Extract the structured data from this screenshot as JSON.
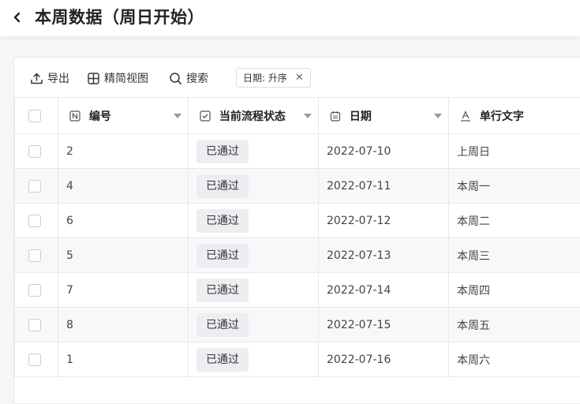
{
  "header": {
    "title": "本周数据（周日开始）"
  },
  "toolbar": {
    "export_label": "导出",
    "view_label": "精简视图",
    "search_label": "搜索",
    "filter_chip": "日期: 升序"
  },
  "table": {
    "columns": [
      "编号",
      "当前流程状态",
      "日期",
      "单行文字"
    ],
    "rows": [
      {
        "id": "2",
        "status": "已通过",
        "date": "2022-07-10",
        "text": "上周日"
      },
      {
        "id": "4",
        "status": "已通过",
        "date": "2022-07-11",
        "text": "本周一"
      },
      {
        "id": "6",
        "status": "已通过",
        "date": "2022-07-12",
        "text": "本周二"
      },
      {
        "id": "5",
        "status": "已通过",
        "date": "2022-07-13",
        "text": "本周三"
      },
      {
        "id": "7",
        "status": "已通过",
        "date": "2022-07-14",
        "text": "本周四"
      },
      {
        "id": "8",
        "status": "已通过",
        "date": "2022-07-15",
        "text": "本周五"
      },
      {
        "id": "1",
        "status": "已通过",
        "date": "2022-07-16",
        "text": "本周六"
      }
    ]
  },
  "icons": {
    "back": "chevron-left-icon",
    "export": "upload-icon",
    "view": "grid-icon",
    "search": "search-icon",
    "number_col": "number-field-icon",
    "status_col": "checkbox-field-icon",
    "date_col": "calendar-field-icon",
    "text_col": "text-field-icon"
  }
}
